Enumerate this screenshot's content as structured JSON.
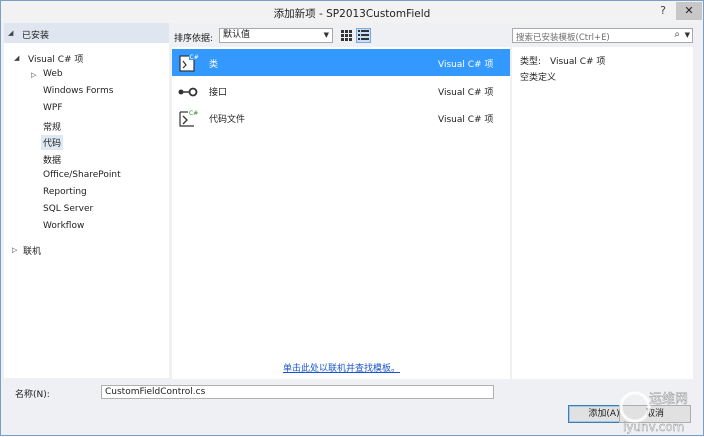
{
  "window": {
    "title": "添加新项 - SP2013CustomField",
    "help_label": "?",
    "close_label": "✕"
  },
  "tree": {
    "header": "已安装",
    "root": "Visual C# 项",
    "children": [
      "Web",
      "Windows Forms",
      "WPF",
      "常规",
      "代码",
      "数据",
      "Office/SharePoint",
      "Reporting",
      "SQL Server",
      "Workflow"
    ],
    "selected": "代码",
    "online": "联机"
  },
  "toolbar": {
    "sort_label": "排序依据:",
    "sort_value": "默认值",
    "search_placeholder": "搜索已安装模板(Ctrl+E)"
  },
  "templates": [
    {
      "name": "类",
      "lang": "Visual C# 项",
      "icon": "class-icon",
      "selected": true
    },
    {
      "name": "接口",
      "lang": "Visual C# 项",
      "icon": "interface-icon",
      "selected": false
    },
    {
      "name": "代码文件",
      "lang": "Visual C# 项",
      "icon": "code-file-icon",
      "selected": false
    }
  ],
  "online_link": "单击此处以联机并查找模板。",
  "details": {
    "type_label": "类型:",
    "type_value": "Visual C# 项",
    "description": "空类定义"
  },
  "name_field": {
    "label": "名称(N):",
    "value": "CustomFieldControl.cs"
  },
  "buttons": {
    "add": "添加(A)",
    "cancel": "取消"
  },
  "watermark": {
    "line1": "运维网",
    "line2": "iyunv.com"
  }
}
